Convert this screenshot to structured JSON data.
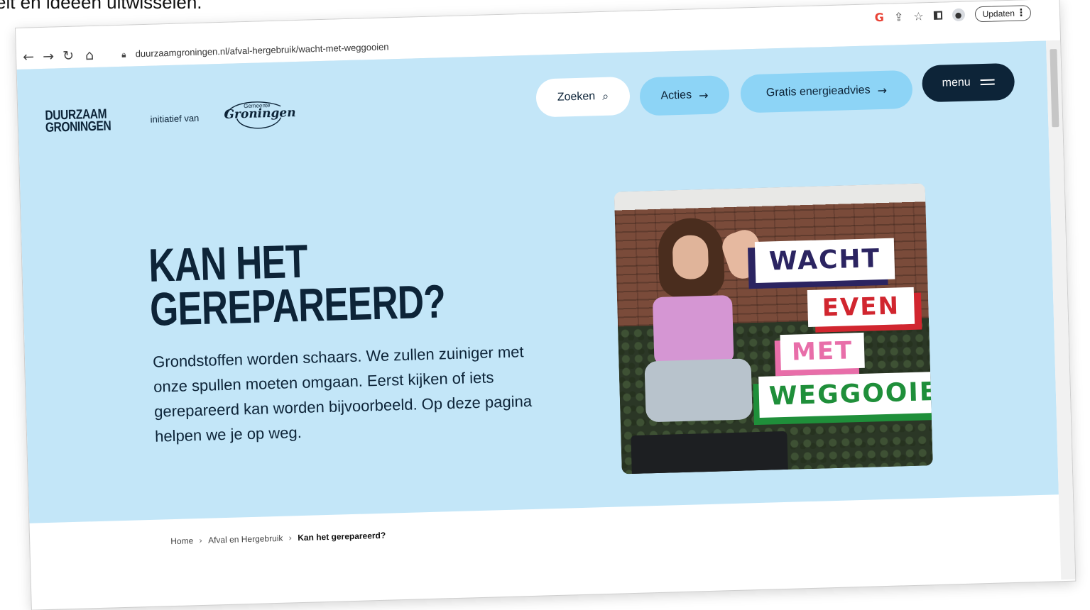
{
  "caption": "eit en ideeën uitwisselen.",
  "browser": {
    "url": "duurzaamgroningen.nl/afval-hergebruik/wacht-met-weggooien",
    "update_label": "Updaten"
  },
  "site": {
    "logo_line1": "DUURZAAM",
    "logo_line2": "GRONINGEN",
    "initiative_text": "initiatief van",
    "municipality_small": "Gemeente",
    "municipality_big": "Groningen"
  },
  "nav": {
    "search_label": "Zoeken",
    "actions_label": "Acties",
    "energy_label": "Gratis energieadvies",
    "menu_label": "menu"
  },
  "hero": {
    "title_line1": "KAN HET",
    "title_line2": "GEREPAREERD?",
    "intro": "Grondstoffen worden schaars. We zullen zuiniger met onze spullen moeten omgaan. Eerst kijken of iets gerepareerd kan worden bijvoorbeeld. Op deze pagina helpen we je op weg.",
    "image_text": {
      "line1": "WACHT",
      "line2": "EVEN",
      "line3": "MET",
      "line4": "WEGGOOIEN"
    }
  },
  "breadcrumb": {
    "home": "Home",
    "section": "Afval en Hergebruik",
    "current": "Kan het gerepareerd?"
  },
  "icons": {
    "back": "back-arrow-icon",
    "forward": "forward-arrow-icon",
    "reload": "reload-icon",
    "home": "home-icon",
    "lock": "lock-icon",
    "search": "search-icon",
    "arrow": "arrow-right-icon",
    "menu": "menu-icon"
  },
  "colors": {
    "page_bg": "#c3e6f8",
    "pill_blue": "#8dd4f6",
    "navy": "#0d2438"
  }
}
